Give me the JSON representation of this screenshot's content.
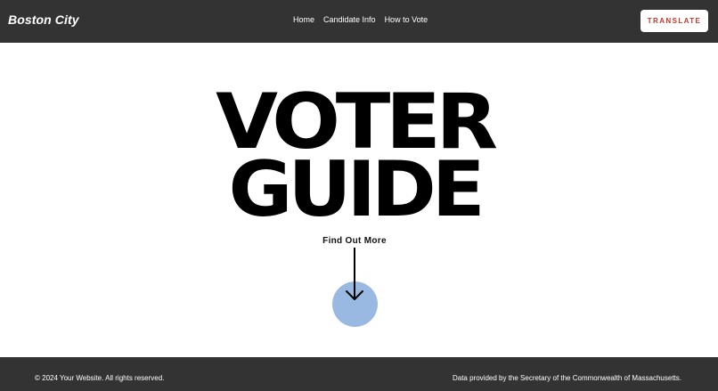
{
  "header": {
    "brand": "Boston City",
    "nav": [
      {
        "label": "Home"
      },
      {
        "label": "Candidate Info"
      },
      {
        "label": "How to Vote"
      }
    ],
    "translate_label": "TRANSLATE"
  },
  "hero": {
    "title_line1": "VOTER",
    "title_line2": "GUIDE",
    "cta_label": "Find Out More",
    "scroll_icon": "arrow-down-icon"
  },
  "footer": {
    "copyright": "© 2024 Your Website. All rights reserved.",
    "data_credit": "Data provided by the Secretary of the Commonwealth of Massachusetts."
  },
  "colors": {
    "header_bg": "#333333",
    "footer_bg": "#333333",
    "translate_text": "#c0392b",
    "circle": "#99b9e2"
  }
}
